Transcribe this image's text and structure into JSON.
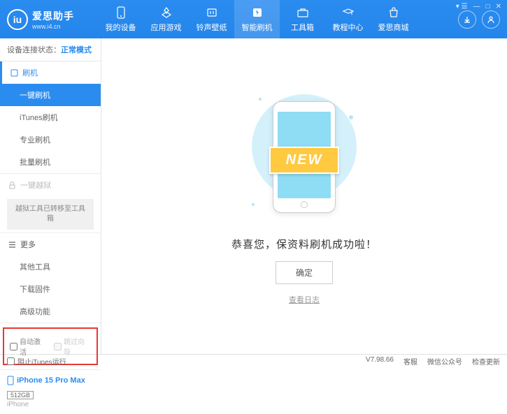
{
  "header": {
    "logo_title": "爱思助手",
    "logo_url": "www.i4.cn",
    "nav": [
      {
        "label": "我的设备"
      },
      {
        "label": "应用游戏"
      },
      {
        "label": "铃声壁纸"
      },
      {
        "label": "智能刷机"
      },
      {
        "label": "工具箱"
      },
      {
        "label": "教程中心"
      },
      {
        "label": "爱思商城"
      }
    ]
  },
  "sidebar": {
    "status_label": "设备连接状态：",
    "status_value": "正常模式",
    "flash_header": "刷机",
    "flash_items": [
      "一键刷机",
      "iTunes刷机",
      "专业刷机",
      "批量刷机"
    ],
    "jailbreak_header": "一键越狱",
    "jailbreak_notice": "越狱工具已转移至工具箱",
    "more_header": "更多",
    "more_items": [
      "其他工具",
      "下载固件",
      "高级功能"
    ],
    "checkboxes": {
      "auto_activate": "自动激活",
      "skip_guide": "跳过向导"
    },
    "device": {
      "name": "iPhone 15 Pro Max",
      "storage": "512GB",
      "type": "iPhone"
    }
  },
  "main": {
    "ribbon": "NEW",
    "success": "恭喜您，保资料刷机成功啦！",
    "confirm": "确定",
    "log": "查看日志"
  },
  "footer": {
    "block_itunes": "阻止iTunes运行",
    "version": "V7.98.66",
    "links": [
      "客服",
      "微信公众号",
      "检查更新"
    ]
  }
}
